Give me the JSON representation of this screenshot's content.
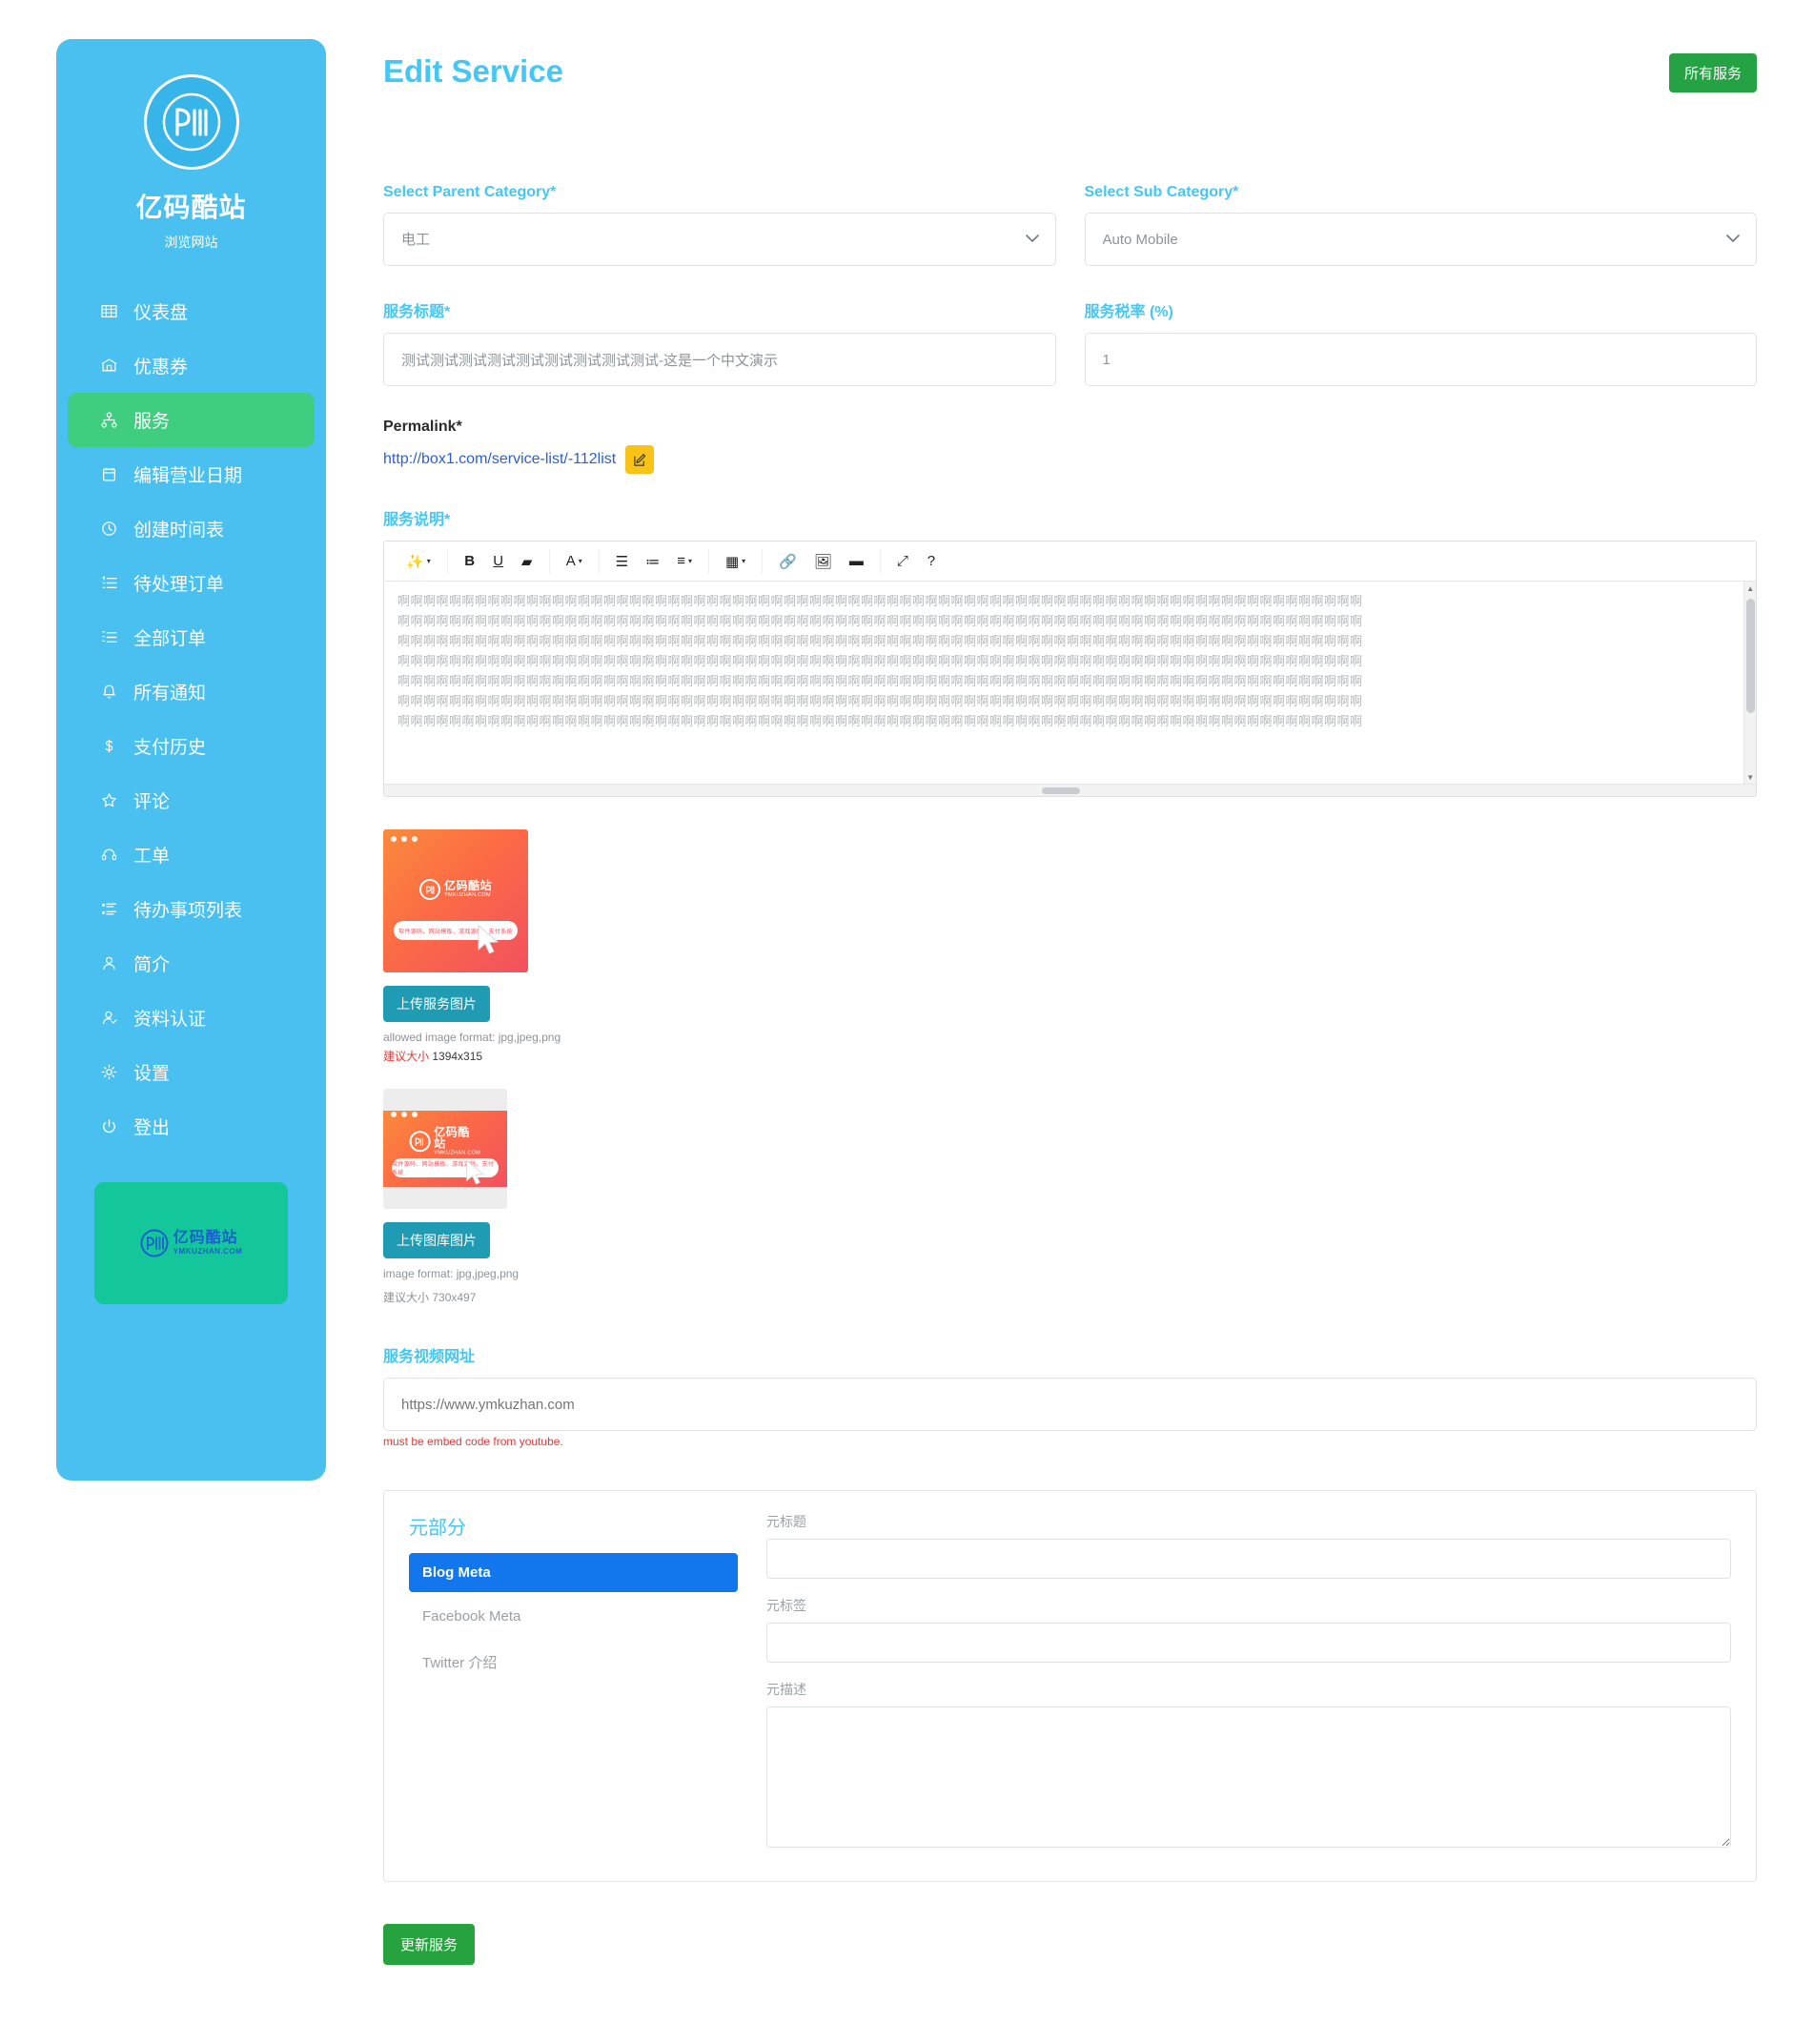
{
  "sidebar": {
    "brand_name": "亿码酷站",
    "brand_sub": "浏览网站",
    "logo_icon": "ym-circle-logo",
    "items": [
      {
        "label": "仪表盘",
        "icon": "grid-icon",
        "active": false
      },
      {
        "label": "优惠券",
        "icon": "ticket-icon",
        "active": false
      },
      {
        "label": "服务",
        "icon": "sitemap-icon",
        "active": true
      },
      {
        "label": "编辑营业日期",
        "icon": "calendar-icon",
        "active": false
      },
      {
        "label": "创建时间表",
        "icon": "clock-icon",
        "active": false
      },
      {
        "label": "待处理订单",
        "icon": "list-pending-icon",
        "active": false
      },
      {
        "label": "全部订单",
        "icon": "list-all-icon",
        "active": false
      },
      {
        "label": "所有通知",
        "icon": "bell-icon",
        "active": false
      },
      {
        "label": "支付历史",
        "icon": "dollar-icon",
        "active": false
      },
      {
        "label": "评论",
        "icon": "star-icon",
        "active": false
      },
      {
        "label": "工单",
        "icon": "headset-icon",
        "active": false
      },
      {
        "label": "待办事项列表",
        "icon": "tasks-icon",
        "active": false
      },
      {
        "label": "简介",
        "icon": "user-icon",
        "active": false
      },
      {
        "label": "资料认证",
        "icon": "user-check-icon",
        "active": false
      },
      {
        "label": "设置",
        "icon": "gear-icon",
        "active": false
      },
      {
        "label": "登出",
        "icon": "power-icon",
        "active": false
      }
    ],
    "promo": {
      "cn": "亿码酷站",
      "en": "YMKUZHAN.COM"
    }
  },
  "header": {
    "title": "Edit Service",
    "all_services_label": "所有服务"
  },
  "form": {
    "parent_category": {
      "label": "Select Parent Category*",
      "value": "电工",
      "options": [
        "电工"
      ]
    },
    "sub_category": {
      "label": "Select Sub Category*",
      "value": "Auto Mobile",
      "options": [
        "Auto Mobile"
      ]
    },
    "service_title": {
      "label": "服务标题*",
      "value": "测试测试测试测试测试测试测试测试测试-这是一个中文演示"
    },
    "service_tax": {
      "label": "服务税率 (%)",
      "value": "1"
    },
    "permalink": {
      "label": "Permalink*",
      "url": "http://box1.com/service-list/-112list",
      "edit_icon": "pencil-square-icon"
    },
    "description": {
      "label": "服务说明*",
      "toolbar": [
        {
          "name": "magic-wand-icon",
          "glyph": "✨",
          "caret": true
        },
        {
          "name": "bold-icon",
          "glyph": "B",
          "caret": false
        },
        {
          "name": "underline-icon",
          "glyph": "U",
          "caret": false
        },
        {
          "name": "eraser-icon",
          "glyph": "▰",
          "caret": false
        },
        {
          "name": "font-color-icon",
          "glyph": "A",
          "caret": true
        },
        {
          "name": "bullet-list-icon",
          "glyph": "☰",
          "caret": false
        },
        {
          "name": "numbered-list-icon",
          "glyph": "≔",
          "caret": false
        },
        {
          "name": "align-icon",
          "glyph": "≡",
          "caret": true
        },
        {
          "name": "table-icon",
          "glyph": "▦",
          "caret": true
        },
        {
          "name": "link-icon",
          "glyph": "🔗",
          "caret": false
        },
        {
          "name": "image-icon",
          "glyph": "🖼",
          "caret": false
        },
        {
          "name": "video-icon",
          "glyph": "▬",
          "caret": false
        },
        {
          "name": "fullscreen-icon",
          "glyph": "⤢",
          "caret": false
        },
        {
          "name": "help-icon",
          "glyph": "?",
          "caret": false
        }
      ],
      "content_lines": [
        "啊啊啊啊啊啊啊啊啊啊啊啊啊啊啊啊啊啊啊啊啊啊啊啊啊啊啊啊啊啊啊啊啊啊啊啊啊啊啊啊啊啊啊啊啊啊啊啊啊啊啊啊啊啊啊啊啊啊啊啊啊啊啊啊啊啊啊啊啊啊啊啊啊啊啊",
        "啊啊啊啊啊啊啊啊啊啊啊啊啊啊啊啊啊啊啊啊啊啊啊啊啊啊啊啊啊啊啊啊啊啊啊啊啊啊啊啊啊啊啊啊啊啊啊啊啊啊啊啊啊啊啊啊啊啊啊啊啊啊啊啊啊啊啊啊啊啊啊啊啊啊啊",
        "啊啊啊啊啊啊啊啊啊啊啊啊啊啊啊啊啊啊啊啊啊啊啊啊啊啊啊啊啊啊啊啊啊啊啊啊啊啊啊啊啊啊啊啊啊啊啊啊啊啊啊啊啊啊啊啊啊啊啊啊啊啊啊啊啊啊啊啊啊啊啊啊啊啊啊",
        "啊啊啊啊啊啊啊啊啊啊啊啊啊啊啊啊啊啊啊啊啊啊啊啊啊啊啊啊啊啊啊啊啊啊啊啊啊啊啊啊啊啊啊啊啊啊啊啊啊啊啊啊啊啊啊啊啊啊啊啊啊啊啊啊啊啊啊啊啊啊啊啊啊啊啊",
        "啊啊啊啊啊啊啊啊啊啊啊啊啊啊啊啊啊啊啊啊啊啊啊啊啊啊啊啊啊啊啊啊啊啊啊啊啊啊啊啊啊啊啊啊啊啊啊啊啊啊啊啊啊啊啊啊啊啊啊啊啊啊啊啊啊啊啊啊啊啊啊啊啊啊啊",
        "啊啊啊啊啊啊啊啊啊啊啊啊啊啊啊啊啊啊啊啊啊啊啊啊啊啊啊啊啊啊啊啊啊啊啊啊啊啊啊啊啊啊啊啊啊啊啊啊啊啊啊啊啊啊啊啊啊啊啊啊啊啊啊啊啊啊啊啊啊啊啊啊啊啊啊",
        "啊啊啊啊啊啊啊啊啊啊啊啊啊啊啊啊啊啊啊啊啊啊啊啊啊啊啊啊啊啊啊啊啊啊啊啊啊啊啊啊啊啊啊啊啊啊啊啊啊啊啊啊啊啊啊啊啊啊啊啊啊啊啊啊啊啊啊啊啊啊啊啊啊啊啊"
      ]
    },
    "service_image": {
      "upload_label": "上传服务图片",
      "format_hint": "allowed image format: jpg,jpeg,png",
      "size_hint_prefix": "建议大小",
      "size_hint_value": "1394x315",
      "thumb_alt": "service-image-preview",
      "pill_text": "软件源码、网站模板、游戏源码、支付系统",
      "brand_cn": "亿码酷站",
      "brand_en": "YMKUZHAN.COM"
    },
    "gallery_image": {
      "upload_label": "上传图库图片",
      "format_hint": "image format: jpg,jpeg,png",
      "size_hint_prefix": "建议大小",
      "size_hint_value": "730x497",
      "thumb_alt": "gallery-image-preview",
      "pill_text": "软件源码、网站模板、游戏源码、支付系统",
      "brand_cn": "亿码酷站",
      "brand_en": "YMKUZHAN.COM"
    },
    "video_url": {
      "label": "服务视频网址",
      "value": "",
      "placeholder": "https://www.ymkuzhan.com",
      "hint": "must be embed code from youtube."
    },
    "submit_label": "更新服务"
  },
  "meta_panel": {
    "title": "元部分",
    "tabs": [
      {
        "label": "Blog Meta",
        "active": true
      },
      {
        "label": "Facebook Meta",
        "active": false
      },
      {
        "label": "Twitter 介绍",
        "active": false
      }
    ],
    "fields": {
      "meta_title_label": "元标题",
      "meta_title_value": "",
      "meta_tag_label": "元标签",
      "meta_tag_value": "",
      "meta_desc_label": "元描述",
      "meta_desc_value": ""
    }
  },
  "colors": {
    "sidebar_bg": "#49c0f0",
    "accent_blue": "#44c7f4",
    "active_green": "#3fce7f",
    "button_green": "#25a244",
    "teal": "#1f9bb3",
    "yellow": "#f8c217",
    "tab_blue": "#1277ec",
    "promo_green": "#14c79a",
    "danger_red": "#e23b3b"
  }
}
